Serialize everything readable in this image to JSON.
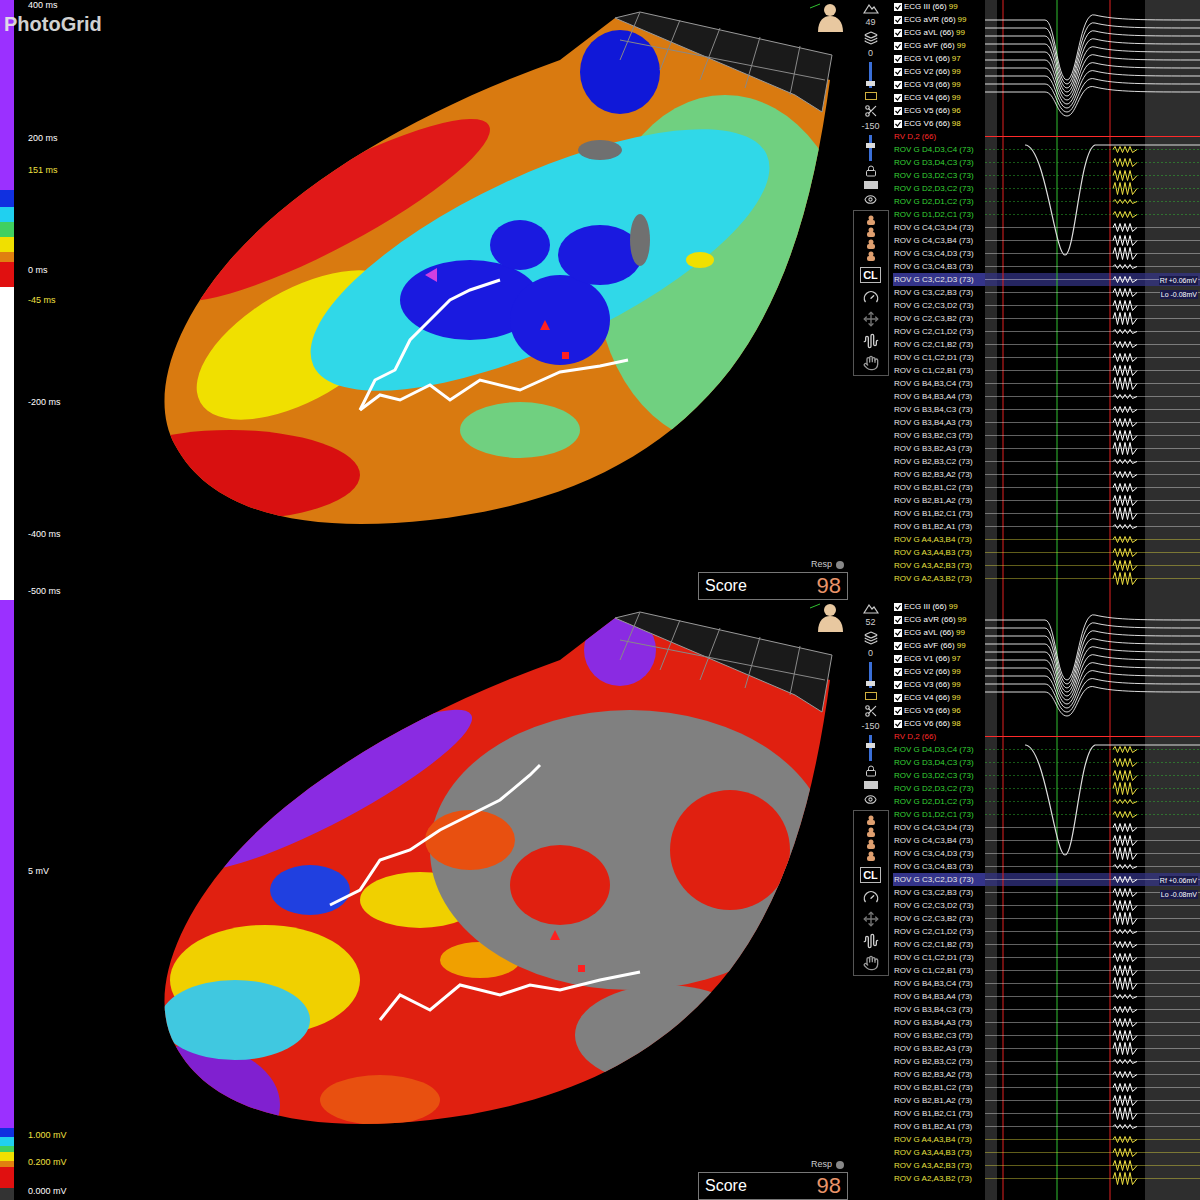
{
  "watermark": "PhotoGrid",
  "markers": [
    "Rf +0.06mV",
    "Lo -0.08mV"
  ],
  "channels": [
    {
      "label": "ECG III (66)",
      "score": "99",
      "kind": "ecg",
      "checked": true,
      "selected": false,
      "color": "#ffffff"
    },
    {
      "label": "ECG aVR (66)",
      "score": "99",
      "kind": "ecg",
      "checked": true,
      "selected": false,
      "color": "#ffffff"
    },
    {
      "label": "ECG aVL (66)",
      "score": "99",
      "kind": "ecg",
      "checked": true,
      "selected": false,
      "color": "#ffffff"
    },
    {
      "label": "ECG aVF (66)",
      "score": "99",
      "kind": "ecg",
      "checked": true,
      "selected": false,
      "color": "#ffffff"
    },
    {
      "label": "ECG V1 (66)",
      "score": "97",
      "kind": "ecg",
      "checked": true,
      "selected": false,
      "color": "#ffffff"
    },
    {
      "label": "ECG V2 (66)",
      "score": "99",
      "kind": "ecg",
      "checked": true,
      "selected": false,
      "color": "#ffffff"
    },
    {
      "label": "ECG V3 (66)",
      "score": "99",
      "kind": "ecg",
      "checked": true,
      "selected": false,
      "color": "#ffffff"
    },
    {
      "label": "ECG V4 (66)",
      "score": "99",
      "kind": "ecg",
      "checked": true,
      "selected": false,
      "color": "#ffffff"
    },
    {
      "label": "ECG V5 (66)",
      "score": "96",
      "kind": "ecg",
      "checked": true,
      "selected": false,
      "color": "#ffffff"
    },
    {
      "label": "ECG V6 (66)",
      "score": "98",
      "kind": "ecg",
      "checked": true,
      "selected": false,
      "color": "#ffffff"
    },
    {
      "label": "RV D,2 (66)",
      "score": "",
      "kind": "ref",
      "checked": false,
      "selected": false,
      "color": "#ff2a2a"
    },
    {
      "label": "ROV G  D4,D3,C4 (73)",
      "score": "",
      "kind": "rov",
      "checked": false,
      "selected": false,
      "color": "#36d436"
    },
    {
      "label": "ROV G  D3,D4,C3 (73)",
      "score": "",
      "kind": "rov",
      "checked": false,
      "selected": false,
      "color": "#36d436"
    },
    {
      "label": "ROV G  D3,D2,C3 (73)",
      "score": "",
      "kind": "rov",
      "checked": false,
      "selected": false,
      "color": "#36d436"
    },
    {
      "label": "ROV G  D2,D3,C2 (73)",
      "score": "",
      "kind": "rov",
      "checked": false,
      "selected": false,
      "color": "#36d436"
    },
    {
      "label": "ROV G  D2,D1,C2 (73)",
      "score": "",
      "kind": "rov",
      "checked": false,
      "selected": false,
      "color": "#36d436"
    },
    {
      "label": "ROV G  D1,D2,C1 (73)",
      "score": "",
      "kind": "rov",
      "checked": false,
      "selected": false,
      "color": "#36d436"
    },
    {
      "label": "ROV G  C4,C3,D4 (73)",
      "score": "",
      "kind": "rov",
      "checked": false,
      "selected": false,
      "color": "#e8e8e8"
    },
    {
      "label": "ROV G  C4,C3,B4 (73)",
      "score": "",
      "kind": "rov",
      "checked": false,
      "selected": false,
      "color": "#e8e8e8"
    },
    {
      "label": "ROV G  C3,C4,D3 (73)",
      "score": "",
      "kind": "rov",
      "checked": false,
      "selected": false,
      "color": "#e8e8e8"
    },
    {
      "label": "ROV G  C3,C4,B3 (73)",
      "score": "",
      "kind": "rov",
      "checked": false,
      "selected": false,
      "color": "#e8e8e8"
    },
    {
      "label": "ROV G  C3,C2,D3 (73)",
      "score": "",
      "kind": "rov",
      "checked": false,
      "selected": true,
      "color": "#e8e8e8"
    },
    {
      "label": "ROV G  C3,C2,B3 (73)",
      "score": "",
      "kind": "rov",
      "checked": false,
      "selected": false,
      "color": "#e8e8e8"
    },
    {
      "label": "ROV G  C2,C3,D2 (73)",
      "score": "",
      "kind": "rov",
      "checked": false,
      "selected": false,
      "color": "#e8e8e8"
    },
    {
      "label": "ROV G  C2,C3,B2 (73)",
      "score": "",
      "kind": "rov",
      "checked": false,
      "selected": false,
      "color": "#e8e8e8"
    },
    {
      "label": "ROV G  C2,C1,D2 (73)",
      "score": "",
      "kind": "rov",
      "checked": false,
      "selected": false,
      "color": "#e8e8e8"
    },
    {
      "label": "ROV G  C2,C1,B2 (73)",
      "score": "",
      "kind": "rov",
      "checked": false,
      "selected": false,
      "color": "#e8e8e8"
    },
    {
      "label": "ROV G  C1,C2,D1 (73)",
      "score": "",
      "kind": "rov",
      "checked": false,
      "selected": false,
      "color": "#e8e8e8"
    },
    {
      "label": "ROV G  C1,C2,B1 (73)",
      "score": "",
      "kind": "rov",
      "checked": false,
      "selected": false,
      "color": "#e8e8e8"
    },
    {
      "label": "ROV G  B4,B3,C4 (73)",
      "score": "",
      "kind": "rov",
      "checked": false,
      "selected": false,
      "color": "#e8e8e8"
    },
    {
      "label": "ROV G  B4,B3,A4 (73)",
      "score": "",
      "kind": "rov",
      "checked": false,
      "selected": false,
      "color": "#e8e8e8"
    },
    {
      "label": "ROV G  B3,B4,C3 (73)",
      "score": "",
      "kind": "rov",
      "checked": false,
      "selected": false,
      "color": "#e8e8e8"
    },
    {
      "label": "ROV G  B3,B4,A3 (73)",
      "score": "",
      "kind": "rov",
      "checked": false,
      "selected": false,
      "color": "#e8e8e8"
    },
    {
      "label": "ROV G  B3,B2,C3 (73)",
      "score": "",
      "kind": "rov",
      "checked": false,
      "selected": false,
      "color": "#e8e8e8"
    },
    {
      "label": "ROV G  B3,B2,A3 (73)",
      "score": "",
      "kind": "rov",
      "checked": false,
      "selected": false,
      "color": "#e8e8e8"
    },
    {
      "label": "ROV G  B2,B3,C2 (73)",
      "score": "",
      "kind": "rov",
      "checked": false,
      "selected": false,
      "color": "#e8e8e8"
    },
    {
      "label": "ROV G  B2,B3,A2 (73)",
      "score": "",
      "kind": "rov",
      "checked": false,
      "selected": false,
      "color": "#e8e8e8"
    },
    {
      "label": "ROV G  B2,B1,C2 (73)",
      "score": "",
      "kind": "rov",
      "checked": false,
      "selected": false,
      "color": "#e8e8e8"
    },
    {
      "label": "ROV G  B2,B1,A2 (73)",
      "score": "",
      "kind": "rov",
      "checked": false,
      "selected": false,
      "color": "#e8e8e8"
    },
    {
      "label": "ROV G  B1,B2,C1 (73)",
      "score": "",
      "kind": "rov",
      "checked": false,
      "selected": false,
      "color": "#e8e8e8"
    },
    {
      "label": "ROV G  B1,B2,A1 (73)",
      "score": "",
      "kind": "rov",
      "checked": false,
      "selected": false,
      "color": "#e8e8e8"
    },
    {
      "label": "ROV G  A4,A3,B4 (73)",
      "score": "",
      "kind": "rov",
      "checked": false,
      "selected": false,
      "color": "#e8e040"
    },
    {
      "label": "ROV G  A3,A4,B3 (73)",
      "score": "",
      "kind": "rov",
      "checked": false,
      "selected": false,
      "color": "#e8e040"
    },
    {
      "label": "ROV G  A3,A2,B3 (73)",
      "score": "",
      "kind": "rov",
      "checked": false,
      "selected": false,
      "color": "#e8e040"
    },
    {
      "label": "ROV G  A2,A3,B2 (73)",
      "score": "",
      "kind": "rov",
      "checked": false,
      "selected": false,
      "color": "#e8e040"
    }
  ],
  "panels": [
    {
      "name": "activation",
      "view_count": "49",
      "zoom": "0",
      "offset": "-150",
      "cl": "CL",
      "resp": "Resp",
      "score_label": "Score",
      "score": "98",
      "scale_labels": [
        {
          "text": "400 ms",
          "color": "#ffffff"
        },
        {
          "text": "200 ms",
          "color": "#ffffff"
        },
        {
          "text": "151 ms",
          "color": "#f0e040"
        },
        {
          "text": "0 ms",
          "color": "#ffffff"
        },
        {
          "text": "-45 ms",
          "color": "#f0e040"
        },
        {
          "text": "-200 ms",
          "color": "#ffffff"
        },
        {
          "text": "-400 ms",
          "color": "#ffffff"
        },
        {
          "text": "-500 ms",
          "color": "#ffffff"
        }
      ],
      "scale_segments": [
        {
          "color": "#9b30ff",
          "level": 0.317
        },
        {
          "color": "#1030e0",
          "level": 0.028
        },
        {
          "color": "#20d0f0",
          "level": 0.025
        },
        {
          "color": "#40d060",
          "level": 0.025
        },
        {
          "color": "#f0e000",
          "level": 0.025
        },
        {
          "color": "#e08010",
          "level": 0.017
        },
        {
          "color": "#e01010",
          "level": 0.042
        },
        {
          "color": "#ffffff",
          "level": 0.521
        }
      ]
    },
    {
      "name": "voltage",
      "view_count": "52",
      "zoom": "0",
      "offset": "-150",
      "cl": "CL",
      "resp": "Resp",
      "score_label": "Score",
      "score": "98",
      "scale_labels": [
        {
          "text": "5 mV",
          "color": "#ffffff"
        },
        {
          "text": "1.000 mV",
          "color": "#f0e040"
        },
        {
          "text": "0.200 mV",
          "color": "#f0e040"
        },
        {
          "text": "0.000 mV",
          "color": "#ffffff"
        }
      ],
      "scale_segments": [
        {
          "color": "#9b30ff",
          "level": 0.88
        },
        {
          "color": "#1030e0",
          "level": 0.015
        },
        {
          "color": "#20d0f0",
          "level": 0.015
        },
        {
          "color": "#40d060",
          "level": 0.01
        },
        {
          "color": "#f0e000",
          "level": 0.015
        },
        {
          "color": "#e08010",
          "level": 0.01
        },
        {
          "color": "#e01010",
          "level": 0.035
        },
        {
          "color": "#333333",
          "level": 0.02
        }
      ]
    }
  ]
}
